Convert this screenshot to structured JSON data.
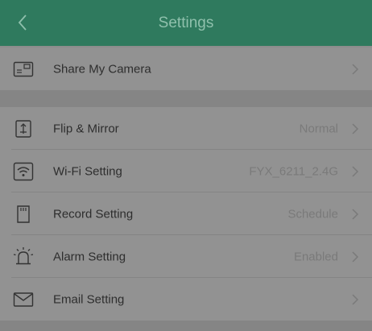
{
  "header": {
    "title": "Settings",
    "back_icon": "chevron-left-icon",
    "color": "#2f7a5e"
  },
  "rows": [
    {
      "id": "share-my-camera",
      "label": "Share My Camera",
      "value": "",
      "icon": "camera-share-icon"
    },
    {
      "id": "flip-mirror",
      "label": "Flip & Mirror",
      "value": "Normal",
      "icon": "flip-mirror-icon"
    },
    {
      "id": "wifi-setting",
      "label": "Wi-Fi Setting",
      "value": "FYX_6211_2.4G",
      "icon": "wifi-icon"
    },
    {
      "id": "record-setting",
      "label": "Record Setting",
      "value": "Schedule",
      "icon": "sd-card-icon"
    },
    {
      "id": "alarm-setting",
      "label": "Alarm Setting",
      "value": "Enabled",
      "icon": "alarm-icon"
    },
    {
      "id": "email-setting",
      "label": "Email Setting",
      "value": "",
      "icon": "envelope-icon"
    }
  ]
}
